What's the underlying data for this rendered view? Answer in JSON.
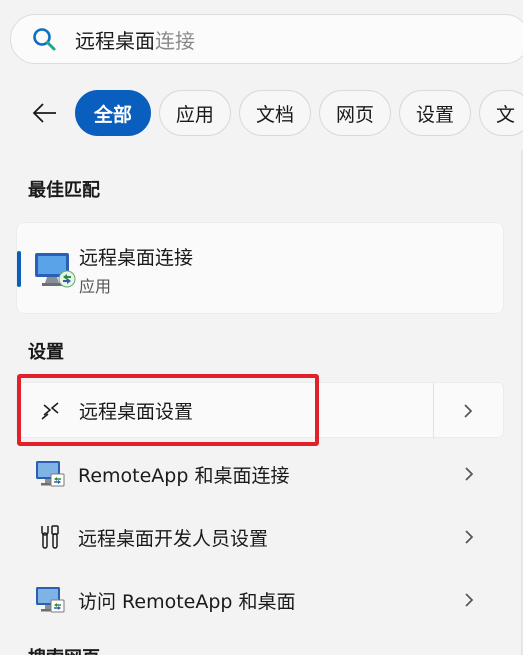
{
  "search": {
    "typed": "远程桌面",
    "suggestion": "连接"
  },
  "filters": {
    "items": [
      "全部",
      "应用",
      "文档",
      "网页",
      "设置",
      "文"
    ]
  },
  "best_match": {
    "section": "最佳匹配",
    "title": "远程桌面连接",
    "subtitle": "应用"
  },
  "settings": {
    "section": "设置",
    "items": [
      {
        "label": "远程桌面设置",
        "icon": "remote-desktop-arrows-icon"
      },
      {
        "label": "RemoteApp 和桌面连接",
        "icon": "remote-desktop-monitor-icon"
      },
      {
        "label": "远程桌面开发人员设置",
        "icon": "developer-tools-icon"
      },
      {
        "label": "访问 RemoteApp 和桌面",
        "icon": "remote-desktop-monitor-icon"
      }
    ]
  },
  "web": {
    "section": "搜索网页"
  },
  "colors": {
    "accent": "#0a5ebd",
    "highlight": "#e0202a"
  }
}
